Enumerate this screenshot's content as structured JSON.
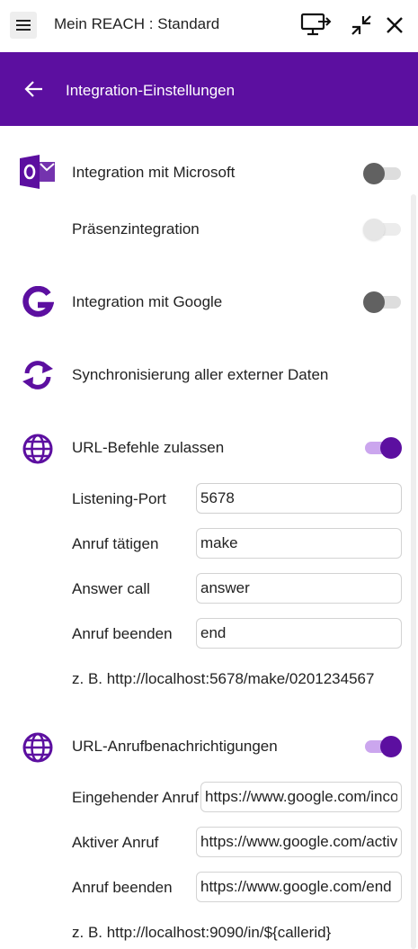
{
  "titlebar": {
    "title": "Mein REACH : Standard",
    "icons": [
      "hamburger-menu-icon",
      "monitor-share-icon",
      "collapse-icon",
      "close-icon"
    ]
  },
  "header": {
    "title": "Integration-Einstellungen",
    "back_icon": "arrow-left-icon",
    "color": "#5c0fa0"
  },
  "rows": {
    "microsoft": {
      "label": "Integration mit Microsoft",
      "icon": "outlook-icon",
      "enabled": false
    },
    "presence": {
      "label": "Präsenzintegration",
      "enabled": false,
      "disabled": true
    },
    "google": {
      "label": "Integration mit Google",
      "icon": "google-icon",
      "enabled": false
    },
    "sync": {
      "label": "Synchronisierung aller externer Daten",
      "icon": "sync-icon"
    },
    "url_commands": {
      "label": "URL-Befehle zulassen",
      "icon": "globe-icon",
      "enabled": true
    },
    "url_notifications": {
      "label": "URL-Anrufbenachrichtigungen",
      "icon": "globe-icon",
      "enabled": true
    }
  },
  "url_commands_fields": [
    {
      "label": "Listening-Port",
      "value": "5678"
    },
    {
      "label": "Anruf tätigen",
      "value": "make"
    },
    {
      "label": "Answer call",
      "value": "answer"
    },
    {
      "label": "Anruf beenden",
      "value": "end"
    }
  ],
  "url_commands_example": "z. B. http://localhost:5678/make/0201234567",
  "url_notifications_fields": [
    {
      "label": "Eingehender Anruf",
      "value": "https://www.google.com/incoming"
    },
    {
      "label": "Aktiver Anruf",
      "value": "https://www.google.com/active"
    },
    {
      "label": "Anruf beenden",
      "value": "https://www.google.com/end"
    }
  ],
  "url_notifications_example": "z. B. http://localhost:9090/in/${callerid}",
  "colors": {
    "accent": "#5c0fa0",
    "accent_light": "#cba6ee"
  }
}
